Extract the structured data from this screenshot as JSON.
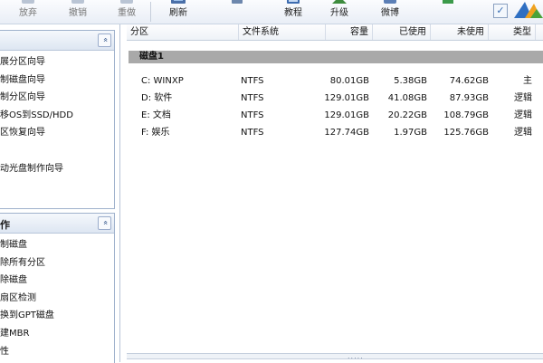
{
  "toolbar": {
    "items": [
      {
        "label": "放弃",
        "icon": "discard-icon",
        "dim": true
      },
      {
        "label": "撤销",
        "icon": "undo-icon",
        "dim": true
      },
      {
        "label": "重做",
        "icon": "redo-icon",
        "dim": true
      },
      {
        "label": "刷新",
        "icon": "refresh-icon",
        "dim": false
      },
      {
        "label": "",
        "icon": "disk-icon",
        "dim": false
      },
      {
        "label": "教程",
        "icon": "tutorial-icon",
        "dim": false
      },
      {
        "label": "升级",
        "icon": "upgrade-icon",
        "dim": false
      },
      {
        "label": "微博",
        "icon": "weibo-icon",
        "dim": false
      },
      {
        "label": "",
        "icon": "app-icon",
        "dim": false
      }
    ],
    "check_glyph": "✓"
  },
  "wizard_panel": {
    "title": "",
    "collapse_glyph": "«",
    "items": [
      "展分区向导",
      "制磁盘向导",
      "制分区向导",
      "移OS到SSD/HDD",
      "区恢复向导",
      "",
      "动光盘制作向导"
    ]
  },
  "operations_panel": {
    "title": "作",
    "collapse_glyph": "«",
    "items": [
      "制磁盘",
      "除所有分区",
      "除磁盘",
      "扇区检测",
      "换到GPT磁盘",
      "建MBR",
      "性"
    ]
  },
  "table": {
    "columns": [
      "分区",
      "文件系统",
      "容量",
      "已使用",
      "未使用",
      "类型"
    ],
    "disk_label": "磁盘1",
    "rows": [
      {
        "partition": "C: WINXP",
        "fs": "NTFS",
        "capacity": "80.01GB",
        "used": "5.38GB",
        "free": "74.62GB",
        "type": "主"
      },
      {
        "partition": "D: 软件",
        "fs": "NTFS",
        "capacity": "129.01GB",
        "used": "41.08GB",
        "free": "87.93GB",
        "type": "逻辑"
      },
      {
        "partition": "E: 文档",
        "fs": "NTFS",
        "capacity": "129.01GB",
        "used": "20.22GB",
        "free": "108.79GB",
        "type": "逻辑"
      },
      {
        "partition": "F: 娱乐",
        "fs": "NTFS",
        "capacity": "127.74GB",
        "used": "1.97GB",
        "free": "125.76GB",
        "type": "逻辑"
      }
    ]
  },
  "splitter_grip": "....."
}
